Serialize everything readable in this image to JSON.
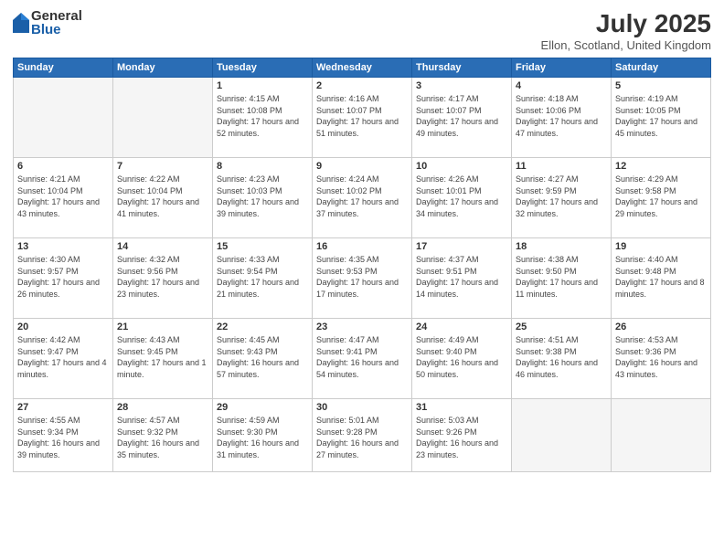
{
  "header": {
    "logo_general": "General",
    "logo_blue": "Blue",
    "title": "July 2025",
    "subtitle": "Ellon, Scotland, United Kingdom"
  },
  "days_of_week": [
    "Sunday",
    "Monday",
    "Tuesday",
    "Wednesday",
    "Thursday",
    "Friday",
    "Saturday"
  ],
  "weeks": [
    [
      {
        "day": "",
        "info": ""
      },
      {
        "day": "",
        "info": ""
      },
      {
        "day": "1",
        "info": "Sunrise: 4:15 AM\nSunset: 10:08 PM\nDaylight: 17 hours and 52 minutes."
      },
      {
        "day": "2",
        "info": "Sunrise: 4:16 AM\nSunset: 10:07 PM\nDaylight: 17 hours and 51 minutes."
      },
      {
        "day": "3",
        "info": "Sunrise: 4:17 AM\nSunset: 10:07 PM\nDaylight: 17 hours and 49 minutes."
      },
      {
        "day": "4",
        "info": "Sunrise: 4:18 AM\nSunset: 10:06 PM\nDaylight: 17 hours and 47 minutes."
      },
      {
        "day": "5",
        "info": "Sunrise: 4:19 AM\nSunset: 10:05 PM\nDaylight: 17 hours and 45 minutes."
      }
    ],
    [
      {
        "day": "6",
        "info": "Sunrise: 4:21 AM\nSunset: 10:04 PM\nDaylight: 17 hours and 43 minutes."
      },
      {
        "day": "7",
        "info": "Sunrise: 4:22 AM\nSunset: 10:04 PM\nDaylight: 17 hours and 41 minutes."
      },
      {
        "day": "8",
        "info": "Sunrise: 4:23 AM\nSunset: 10:03 PM\nDaylight: 17 hours and 39 minutes."
      },
      {
        "day": "9",
        "info": "Sunrise: 4:24 AM\nSunset: 10:02 PM\nDaylight: 17 hours and 37 minutes."
      },
      {
        "day": "10",
        "info": "Sunrise: 4:26 AM\nSunset: 10:01 PM\nDaylight: 17 hours and 34 minutes."
      },
      {
        "day": "11",
        "info": "Sunrise: 4:27 AM\nSunset: 9:59 PM\nDaylight: 17 hours and 32 minutes."
      },
      {
        "day": "12",
        "info": "Sunrise: 4:29 AM\nSunset: 9:58 PM\nDaylight: 17 hours and 29 minutes."
      }
    ],
    [
      {
        "day": "13",
        "info": "Sunrise: 4:30 AM\nSunset: 9:57 PM\nDaylight: 17 hours and 26 minutes."
      },
      {
        "day": "14",
        "info": "Sunrise: 4:32 AM\nSunset: 9:56 PM\nDaylight: 17 hours and 23 minutes."
      },
      {
        "day": "15",
        "info": "Sunrise: 4:33 AM\nSunset: 9:54 PM\nDaylight: 17 hours and 21 minutes."
      },
      {
        "day": "16",
        "info": "Sunrise: 4:35 AM\nSunset: 9:53 PM\nDaylight: 17 hours and 17 minutes."
      },
      {
        "day": "17",
        "info": "Sunrise: 4:37 AM\nSunset: 9:51 PM\nDaylight: 17 hours and 14 minutes."
      },
      {
        "day": "18",
        "info": "Sunrise: 4:38 AM\nSunset: 9:50 PM\nDaylight: 17 hours and 11 minutes."
      },
      {
        "day": "19",
        "info": "Sunrise: 4:40 AM\nSunset: 9:48 PM\nDaylight: 17 hours and 8 minutes."
      }
    ],
    [
      {
        "day": "20",
        "info": "Sunrise: 4:42 AM\nSunset: 9:47 PM\nDaylight: 17 hours and 4 minutes."
      },
      {
        "day": "21",
        "info": "Sunrise: 4:43 AM\nSunset: 9:45 PM\nDaylight: 17 hours and 1 minute."
      },
      {
        "day": "22",
        "info": "Sunrise: 4:45 AM\nSunset: 9:43 PM\nDaylight: 16 hours and 57 minutes."
      },
      {
        "day": "23",
        "info": "Sunrise: 4:47 AM\nSunset: 9:41 PM\nDaylight: 16 hours and 54 minutes."
      },
      {
        "day": "24",
        "info": "Sunrise: 4:49 AM\nSunset: 9:40 PM\nDaylight: 16 hours and 50 minutes."
      },
      {
        "day": "25",
        "info": "Sunrise: 4:51 AM\nSunset: 9:38 PM\nDaylight: 16 hours and 46 minutes."
      },
      {
        "day": "26",
        "info": "Sunrise: 4:53 AM\nSunset: 9:36 PM\nDaylight: 16 hours and 43 minutes."
      }
    ],
    [
      {
        "day": "27",
        "info": "Sunrise: 4:55 AM\nSunset: 9:34 PM\nDaylight: 16 hours and 39 minutes."
      },
      {
        "day": "28",
        "info": "Sunrise: 4:57 AM\nSunset: 9:32 PM\nDaylight: 16 hours and 35 minutes."
      },
      {
        "day": "29",
        "info": "Sunrise: 4:59 AM\nSunset: 9:30 PM\nDaylight: 16 hours and 31 minutes."
      },
      {
        "day": "30",
        "info": "Sunrise: 5:01 AM\nSunset: 9:28 PM\nDaylight: 16 hours and 27 minutes."
      },
      {
        "day": "31",
        "info": "Sunrise: 5:03 AM\nSunset: 9:26 PM\nDaylight: 16 hours and 23 minutes."
      },
      {
        "day": "",
        "info": ""
      },
      {
        "day": "",
        "info": ""
      }
    ]
  ]
}
